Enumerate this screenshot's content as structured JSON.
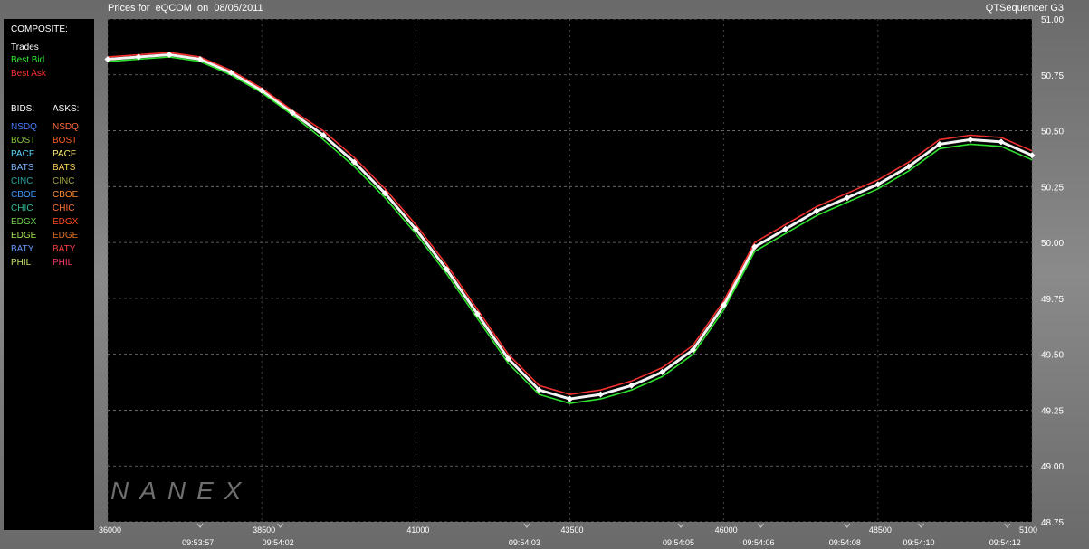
{
  "header": {
    "title": "Prices for  eQCOM  on  08/05/2011",
    "app": "QTSequencer G3"
  },
  "watermark": "NANEX",
  "legend": {
    "composite_label": "COMPOSITE:",
    "composite": [
      {
        "label": "Trades",
        "color": "#ffffff"
      },
      {
        "label": "Best Bid",
        "color": "#33ee33"
      },
      {
        "label": "Best Ask",
        "color": "#ff3333"
      }
    ],
    "bids_label": "BIDS:",
    "asks_label": "ASKS:",
    "exchanges": [
      {
        "bid": "NSDQ",
        "ask": "NSDQ",
        "bid_color": "#4a7dff",
        "ask_color": "#ff6a3a"
      },
      {
        "bid": "BOST",
        "ask": "BOST",
        "bid_color": "#88c040",
        "ask_color": "#ff5a2a"
      },
      {
        "bid": "PACF",
        "ask": "PACF",
        "bid_color": "#58d8ff",
        "ask_color": "#fff070"
      },
      {
        "bid": "BATS",
        "ask": "BATS",
        "bid_color": "#7ab8ff",
        "ask_color": "#ffd25a"
      },
      {
        "bid": "CINC",
        "ask": "CINC",
        "bid_color": "#2aa0a0",
        "ask_color": "#a0a040"
      },
      {
        "bid": "CBOE",
        "ask": "CBOE",
        "bid_color": "#3a9cff",
        "ask_color": "#ff8a30"
      },
      {
        "bid": "CHIC",
        "ask": "CHIC",
        "bid_color": "#30c0a0",
        "ask_color": "#ff7030"
      },
      {
        "bid": "EDGX",
        "ask": "EDGX",
        "bid_color": "#70d050",
        "ask_color": "#ff4a20"
      },
      {
        "bid": "EDGE",
        "ask": "EDGE",
        "bid_color": "#a0e050",
        "ask_color": "#e07020"
      },
      {
        "bid": "BATY",
        "ask": "BATY",
        "bid_color": "#6a9aff",
        "ask_color": "#ff4040"
      },
      {
        "bid": "PHIL",
        "ask": "PHIL",
        "bid_color": "#c0e060",
        "ask_color": "#ff3a6a"
      }
    ]
  },
  "chart_data": {
    "type": "line",
    "title": "Prices for  eQCOM  on  08/05/2011",
    "ylim": [
      48.75,
      51.0
    ],
    "y_ticks": [
      "51.00",
      "50.75",
      "50.50",
      "50.25",
      "50.00",
      "49.75",
      "49.50",
      "49.25",
      "49.00",
      "48.75"
    ],
    "x_range": [
      36000,
      51000
    ],
    "x_ticks": [
      "36000",
      "38500",
      "41000",
      "43500",
      "46000",
      "48500",
      "5100"
    ],
    "time_ticks": [
      {
        "seq": 37500,
        "label": "09:53:57"
      },
      {
        "seq": 38800,
        "label": "09:54:02"
      },
      {
        "seq": 42800,
        "label": "09:54:03"
      },
      {
        "seq": 45300,
        "label": "09:54:05"
      },
      {
        "seq": 46600,
        "label": "09:54:06"
      },
      {
        "seq": 48000,
        "label": "09:54:08"
      },
      {
        "seq": 49200,
        "label": "09:54:10"
      },
      {
        "seq": 50600,
        "label": "09:54:12"
      }
    ],
    "grid": true,
    "series": [
      {
        "name": "Trades",
        "color": "#ffffff",
        "x": [
          36000,
          36500,
          37000,
          37500,
          38000,
          38500,
          39000,
          39500,
          40000,
          40500,
          41000,
          41500,
          42000,
          42500,
          43000,
          43500,
          44000,
          44500,
          45000,
          45500,
          46000,
          46500,
          47000,
          47500,
          48000,
          48500,
          49000,
          49500,
          50000,
          50500,
          51000
        ],
        "values": [
          50.82,
          50.83,
          50.84,
          50.82,
          50.76,
          50.68,
          50.58,
          50.48,
          50.36,
          50.22,
          50.06,
          49.88,
          49.68,
          49.48,
          49.34,
          49.3,
          49.32,
          49.36,
          49.42,
          49.52,
          49.72,
          49.98,
          50.06,
          50.14,
          50.2,
          50.26,
          50.34,
          50.44,
          50.46,
          50.45,
          50.39
        ]
      },
      {
        "name": "Best Bid",
        "color": "#33ee33",
        "x": [
          36000,
          36500,
          37000,
          37500,
          38000,
          38500,
          39000,
          39500,
          40000,
          40500,
          41000,
          41500,
          42000,
          42500,
          43000,
          43500,
          44000,
          44500,
          45000,
          45500,
          46000,
          46500,
          47000,
          47500,
          48000,
          48500,
          49000,
          49500,
          50000,
          50500,
          51000
        ],
        "values": [
          50.81,
          50.82,
          50.83,
          50.81,
          50.75,
          50.67,
          50.57,
          50.46,
          50.34,
          50.2,
          50.04,
          49.86,
          49.66,
          49.46,
          49.32,
          49.28,
          49.3,
          49.34,
          49.4,
          49.5,
          49.7,
          49.96,
          50.04,
          50.12,
          50.18,
          50.24,
          50.32,
          50.42,
          50.44,
          50.43,
          50.37
        ]
      },
      {
        "name": "Best Ask",
        "color": "#ff3333",
        "x": [
          36000,
          36500,
          37000,
          37500,
          38000,
          38500,
          39000,
          39500,
          40000,
          40500,
          41000,
          41500,
          42000,
          42500,
          43000,
          43500,
          44000,
          44500,
          45000,
          45500,
          46000,
          46500,
          47000,
          47500,
          48000,
          48500,
          49000,
          49500,
          50000,
          50500,
          51000
        ],
        "values": [
          50.83,
          50.84,
          50.85,
          50.83,
          50.77,
          50.69,
          50.59,
          50.5,
          50.38,
          50.24,
          50.08,
          49.9,
          49.7,
          49.5,
          49.36,
          49.32,
          49.34,
          49.38,
          49.44,
          49.54,
          49.74,
          50.0,
          50.08,
          50.16,
          50.22,
          50.28,
          50.36,
          50.46,
          50.48,
          50.47,
          50.41
        ]
      }
    ]
  }
}
